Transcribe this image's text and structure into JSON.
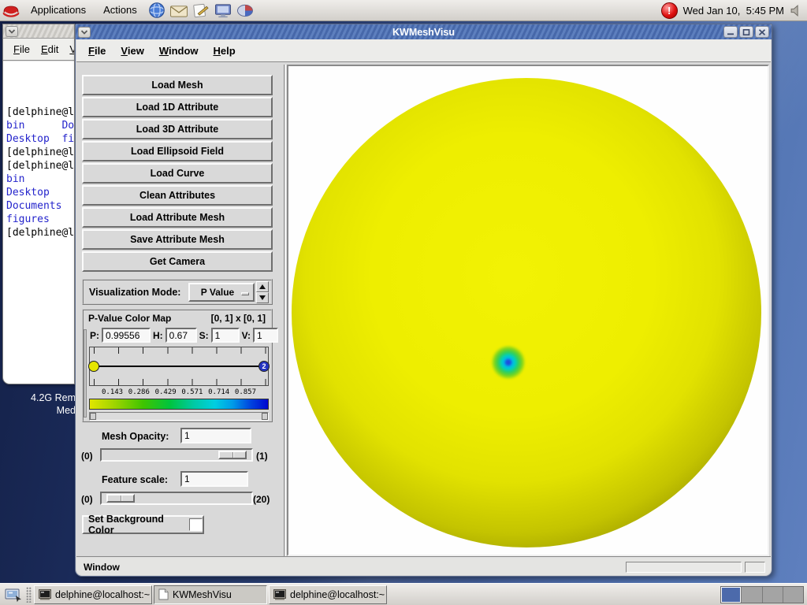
{
  "top_panel": {
    "menus": [
      {
        "label": "Applications"
      },
      {
        "label": "Actions"
      }
    ],
    "launcher_icons": [
      "web-browser-icon",
      "email-icon",
      "writer-icon",
      "display-icon",
      "chart-icon"
    ],
    "alert_label": "!",
    "clock": "Wed Jan 10,  5:45 PM"
  },
  "desktop": {
    "media_label": [
      {
        "text": "4.2G Rem"
      },
      {
        "text": "Med"
      }
    ]
  },
  "terminal_window": {
    "menus": [
      {
        "label": "File"
      },
      {
        "label": "Edit"
      },
      {
        "label": "View"
      }
    ],
    "lines": [
      {
        "text": "[delphine@l",
        "color": "c-black"
      },
      {
        "text": "bin      Do",
        "color": "c-blue"
      },
      {
        "text": "Desktop  fi",
        "color": "c-blue"
      },
      {
        "text": "[delphine@l",
        "color": "c-black"
      },
      {
        "text": "[delphine@l",
        "color": "c-black"
      },
      {
        "text": "bin",
        "color": "c-blue"
      },
      {
        "text": "Desktop",
        "color": "c-blue"
      },
      {
        "text": "Documents",
        "color": "c-blue"
      },
      {
        "text": "figures",
        "color": "c-blue"
      },
      {
        "text": "[delphine@l",
        "color": "c-black"
      }
    ]
  },
  "main_window": {
    "title": "KWMeshVisu",
    "menus": [
      {
        "label": "File"
      },
      {
        "label": "View"
      },
      {
        "label": "Window"
      },
      {
        "label": "Help"
      }
    ],
    "action_buttons": [
      {
        "label": "Load Mesh"
      },
      {
        "label": "Load 1D Attribute"
      },
      {
        "label": "Load 3D Attribute"
      },
      {
        "label": "Load Ellipsoid Field"
      },
      {
        "label": "Load Curve"
      },
      {
        "label": "Clean Attributes"
      },
      {
        "label": "Load Attribute Mesh"
      },
      {
        "label": "Save Attribute Mesh"
      },
      {
        "label": "Get Camera"
      }
    ],
    "visualization_mode": {
      "label": "Visualization Mode:",
      "value": "P Value"
    },
    "colormap": {
      "title": "P-Value Color Map",
      "range": "[0, 1] x [0, 1]",
      "fields": [
        {
          "label": "P:",
          "value": "0.99556"
        },
        {
          "label": "H:",
          "value": "0.67"
        },
        {
          "label": "S:",
          "value": "1"
        },
        {
          "label": "V:",
          "value": "1"
        }
      ],
      "tick_labels": [
        {
          "label": "0.143"
        },
        {
          "label": "0.286"
        },
        {
          "label": "0.429"
        },
        {
          "label": "0.571"
        },
        {
          "label": "0.714"
        },
        {
          "label": "0.857"
        }
      ],
      "right_handle_label": "2"
    },
    "mesh_opacity": {
      "label": "Mesh Opacity:",
      "value": "1",
      "min_label": "(0)",
      "max_label": "(1)"
    },
    "feature_scale": {
      "label": "Feature scale:",
      "value": "1",
      "min_label": "(0)",
      "max_label": "(20)"
    },
    "set_background_button": "Set Background Color",
    "status_label": "Window"
  },
  "taskbar": {
    "buttons": [
      {
        "label": "delphine@localhost:~",
        "cls": "terminal"
      },
      {
        "label": "KWMeshVisu",
        "cls": "document active"
      },
      {
        "label": "delphine@localhost:~",
        "cls": "terminal"
      }
    ],
    "workspaces": [
      {
        "cls": "active"
      },
      {
        "cls": "inactive"
      },
      {
        "cls": "inactive"
      },
      {
        "cls": "inactive"
      }
    ]
  },
  "colors": {
    "titlebar_active": "#4a6bac",
    "desktop_dark": "#16224a",
    "desktop_light": "#5c7cba",
    "sphere_yellow": "#eeee00",
    "spot_blue": "#2746d6",
    "spot_cyan": "#00cfe0",
    "spot_green": "#44cc33",
    "terminal_dir_blue": "#2424cc"
  }
}
